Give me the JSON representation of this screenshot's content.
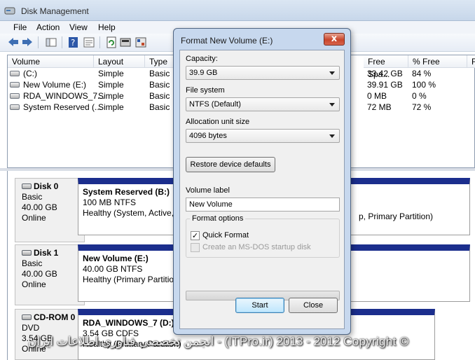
{
  "window": {
    "title": "Disk Management"
  },
  "menu": [
    "File",
    "Action",
    "View",
    "Help"
  ],
  "toolbar": {
    "buttons": [
      "back-icon",
      "forward-icon",
      "console-tree-icon",
      "help-icon",
      "properties-icon",
      "refresh-icon",
      "settings-icon"
    ]
  },
  "volume_list": {
    "columns": [
      "Volume",
      "Layout",
      "Type",
      "Free Spa...",
      "% Free",
      "F"
    ],
    "rows": [
      {
        "volume": "(C:)",
        "layout": "Simple",
        "type": "Basic",
        "free": "33.42 GB",
        "pct": "84 %"
      },
      {
        "volume": "New Volume (E:)",
        "layout": "Simple",
        "type": "Basic",
        "free": "39.91 GB",
        "pct": "100 %"
      },
      {
        "volume": "RDA_WINDOWS_7...",
        "layout": "Simple",
        "type": "Basic",
        "free": "0 MB",
        "pct": "0 %"
      },
      {
        "volume": "System Reserved (...",
        "layout": "Simple",
        "type": "Basic",
        "free": "72 MB",
        "pct": "72 %"
      }
    ]
  },
  "disks": [
    {
      "name": "Disk 0",
      "kind": "Basic",
      "size": "40.00 GB",
      "status": "Online",
      "partition": {
        "name": "System Reserved  (B:)",
        "detail": "100 MB NTFS",
        "health": "Healthy (System, Active, P"
      },
      "extra_health": "p, Primary Partition)"
    },
    {
      "name": "Disk 1",
      "kind": "Basic",
      "size": "40.00 GB",
      "status": "Online",
      "partition": {
        "name": "New Volume  (E:)",
        "detail": "40.00 GB NTFS",
        "health": "Healthy (Primary Partition"
      }
    },
    {
      "name": "CD-ROM 0",
      "kind": "DVD",
      "size": "3.54 GB",
      "status": "Online",
      "partition": {
        "name": "RDA_WINDOWS_7  (D:)",
        "detail": "3.54 GB CDFS",
        "health": "Healthy (Primary Partition)"
      }
    }
  ],
  "dialog": {
    "title": "Format New Volume (E:)",
    "close_label": "x",
    "capacity_label": "Capacity:",
    "capacity_value": "39.9 GB",
    "fs_label": "File system",
    "fs_value": "NTFS (Default)",
    "alloc_label": "Allocation unit size",
    "alloc_value": "4096 bytes",
    "restore_label": "Restore device defaults",
    "volume_label_label": "Volume label",
    "volume_label_value": "New Volume",
    "format_options_label": "Format options",
    "quick_format_label": "Quick Format",
    "quick_format_checked": true,
    "msdos_label": "Create an MS-DOS startup disk",
    "msdos_checked": false,
    "progress": 0,
    "start_label": "Start",
    "close_button_label": "Close"
  },
  "watermark": "انجمن تخصصی فناوری اطلاعات ایران - (ITPro.ir) 2013 - 2012 Copyright ©"
}
